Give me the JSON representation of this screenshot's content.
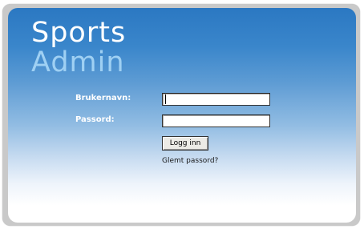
{
  "logo": {
    "line1": "Sports",
    "line2": "Admin"
  },
  "form": {
    "username_label": "Brukernavn:",
    "username_value": "",
    "password_label": "Passord:",
    "password_value": "",
    "login_button": "Logg inn",
    "forgot_link": "Glemt passord?"
  },
  "colors": {
    "panel_top": "#2b78c2",
    "panel_bottom": "#ffffff",
    "logo_sports": "#ffffff",
    "logo_admin": "#9fd0f3"
  }
}
